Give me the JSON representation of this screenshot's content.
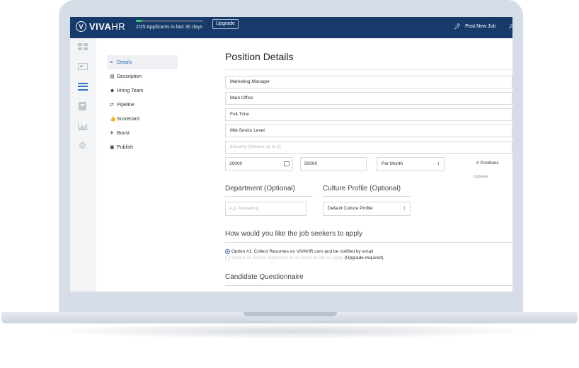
{
  "topbar": {
    "logo_mark": "V",
    "logo_bold": "VIVA",
    "logo_light": "HR",
    "applicants_text": "2/25 Applicants in last 30 days",
    "applicants_progress": 0.08,
    "upgrade_label": "Upgrade",
    "post_job_label": "Post New Job"
  },
  "rail": {
    "icons": [
      "dashboard-icon",
      "jobs-icon",
      "list-icon",
      "candidates-icon",
      "reports-icon",
      "settings-icon"
    ]
  },
  "menu": {
    "items": [
      {
        "label": "Details",
        "icon": "≡",
        "active": true
      },
      {
        "label": "Description",
        "icon": "▤"
      },
      {
        "label": "Hiring Team",
        "icon": "☻"
      },
      {
        "label": "Pipeline",
        "icon": "⇄"
      },
      {
        "label": "Scorecard",
        "icon": "👍"
      },
      {
        "label": "Boost",
        "icon": "✈"
      },
      {
        "label": "Publish",
        "icon": "▣"
      }
    ]
  },
  "form": {
    "title": "Position Details",
    "job_title": "Marketing Manager",
    "location": "Main Office",
    "employment_type": "Full-Time",
    "experience_level": "Mid-Senior Level",
    "industry_placeholder": "Industry (choose up to 3)",
    "salary_min": "20000",
    "salary_max": "50000",
    "pay_period": "Per Month",
    "positions_placeholder": "# Positions",
    "positions_helper": "Optional",
    "department_label": "Department (Optional)",
    "department_placeholder": "e.g. Marketing",
    "culture_label": "Culture Profile (Optional)",
    "culture_value": "Default Culture Profile",
    "apply_heading": "How would you like the job seekers to apply",
    "option1": "Option #1: Collect Resumes on VIVAHR.com and be notified by email",
    "option2_dim": "Option #2: Direct Applicants to an external site to apply",
    "option2_strong": "(Upgrade required)",
    "questionnaire_heading": "Candidate Questionnaire"
  },
  "colors": {
    "topbar": "#163b6a",
    "accent": "#2a74c9",
    "progress": "#35c66e"
  }
}
